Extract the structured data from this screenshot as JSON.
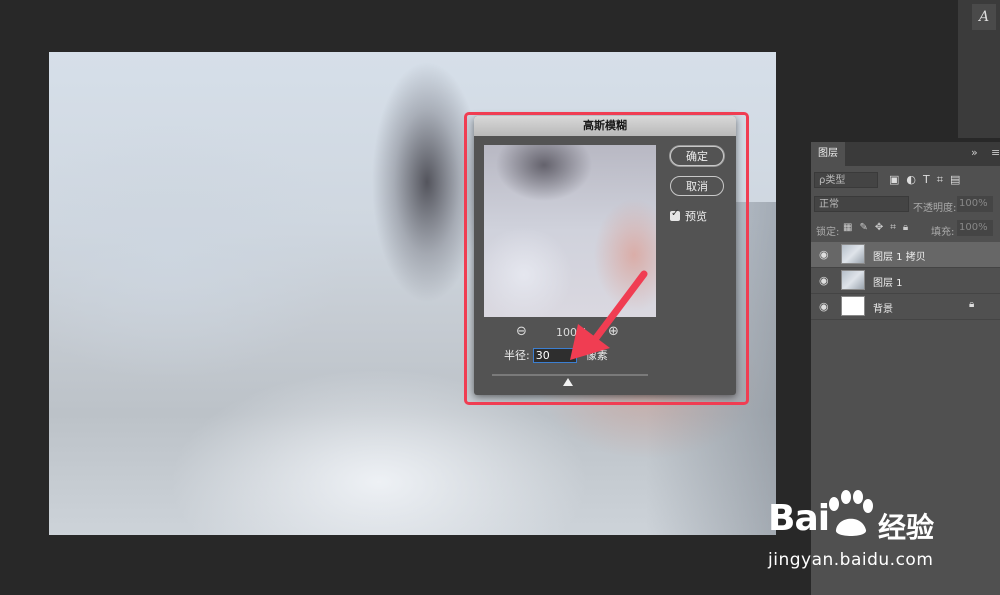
{
  "dialog": {
    "title": "高斯模糊",
    "ok_label": "确定",
    "cancel_label": "取消",
    "preview_label": "预览",
    "preview_checked": true,
    "zoom_value": "100%",
    "radius_label": "半径:",
    "radius_value": "30",
    "radius_unit": "像素"
  },
  "top_strip": {
    "icon": "A"
  },
  "layers_panel": {
    "tab_label": "图层",
    "collapse_icon": "»",
    "menu_icon": "≡",
    "filter_kind": "ρ类型",
    "filter_icons": [
      "image-icon",
      "adjustment-icon",
      "T",
      "shape-icon",
      "smart-object-icon"
    ],
    "blend_mode": "正常",
    "opacity_label": "不透明度:",
    "opacity_value": "100%",
    "lock_label": "锁定:",
    "fill_label": "填充:",
    "fill_value": "100%",
    "layers": [
      {
        "name": "图层 1 拷贝",
        "selected": true,
        "thumb": "image"
      },
      {
        "name": "图层 1",
        "selected": false,
        "thumb": "image"
      },
      {
        "name": "背景",
        "selected": false,
        "thumb": "white",
        "locked": true
      }
    ]
  },
  "watermark": {
    "brand": "Bai",
    "brand_cn": "经验",
    "url": "jingyan.baidu.com"
  },
  "colors": {
    "highlight": "#f03d52",
    "arrow": "#f03d52",
    "panel_bg": "#505050",
    "dialog_bg": "#535353"
  }
}
